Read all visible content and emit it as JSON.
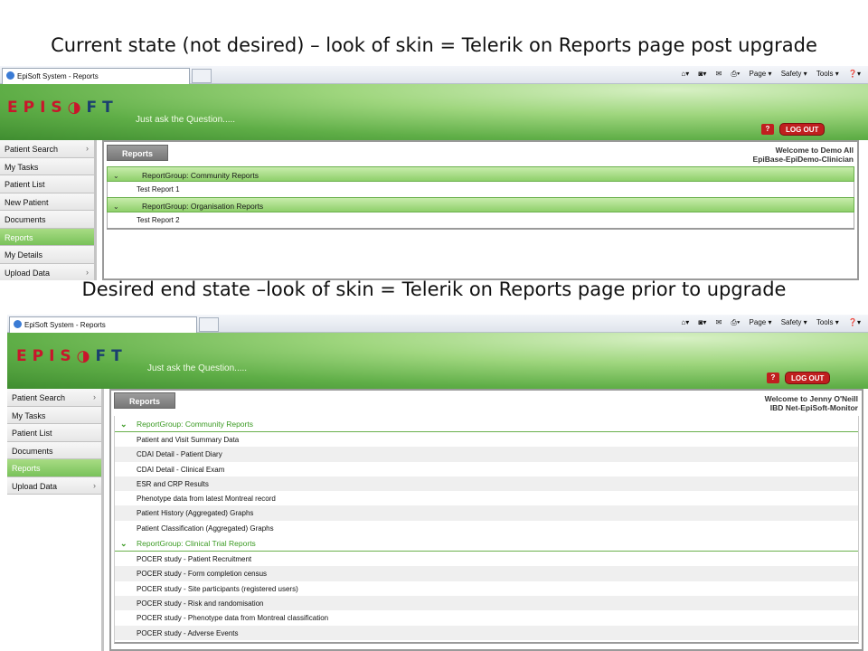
{
  "captions": {
    "top": "Current state (not desired) – look of skin = Telerik on Reports page post upgrade",
    "bottom": "Desired end state –look of skin = Telerik on Reports page prior to upgrade"
  },
  "browser": {
    "tab_title": "EpiSoft System - Reports",
    "commands": [
      "Page ▾",
      "Safety ▾",
      "Tools ▾"
    ]
  },
  "banner": {
    "logo_left": "EPIS",
    "logo_right": "FT",
    "tagline": "Just ask the Question.....",
    "help_label": "?",
    "logout_label": "LOG OUT"
  },
  "current": {
    "sidebar": [
      "Patient Search",
      "My Tasks",
      "Patient List",
      "New Patient",
      "Documents",
      "Reports",
      "My Details",
      "Upload Data"
    ],
    "active": "Reports",
    "tab_label": "Reports",
    "welcome_line1": "Welcome to Demo All",
    "welcome_line2": "EpiBase-EpiDemo-Clinician",
    "groups": [
      {
        "label": "ReportGroup: Community Reports",
        "items": [
          "Test Report 1"
        ]
      },
      {
        "label": "ReportGroup: Organisation Reports",
        "items": [
          "Test Report 2"
        ]
      }
    ]
  },
  "desired": {
    "sidebar": [
      "Patient Search",
      "My Tasks",
      "Patient List",
      "Documents",
      "Reports",
      "Upload Data"
    ],
    "active": "Reports",
    "tab_label": "Reports",
    "welcome_line1": "Welcome to Jenny O'Neill",
    "welcome_line2": "IBD Net-EpiSoft-Monitor",
    "groups": [
      {
        "label": "ReportGroup: Community Reports",
        "items": [
          "Patient and Visit Summary Data",
          "CDAI Detail - Patient Diary",
          "CDAI Detail - Clinical Exam",
          "ESR and CRP Results",
          "Phenotype data from latest Montreal record",
          "Patient History (Aggregated) Graphs",
          "Patient Classification (Aggregated) Graphs"
        ]
      },
      {
        "label": "ReportGroup: Clinical Trial Reports",
        "items": [
          "POCER study - Patient Recruitment",
          "POCER study - Form completion census",
          "POCER study - Site participants (registered users)",
          "POCER study - Risk and randomisation",
          "POCER study - Phenotype data from Montreal classification",
          "POCER study - Adverse Events"
        ]
      }
    ]
  }
}
